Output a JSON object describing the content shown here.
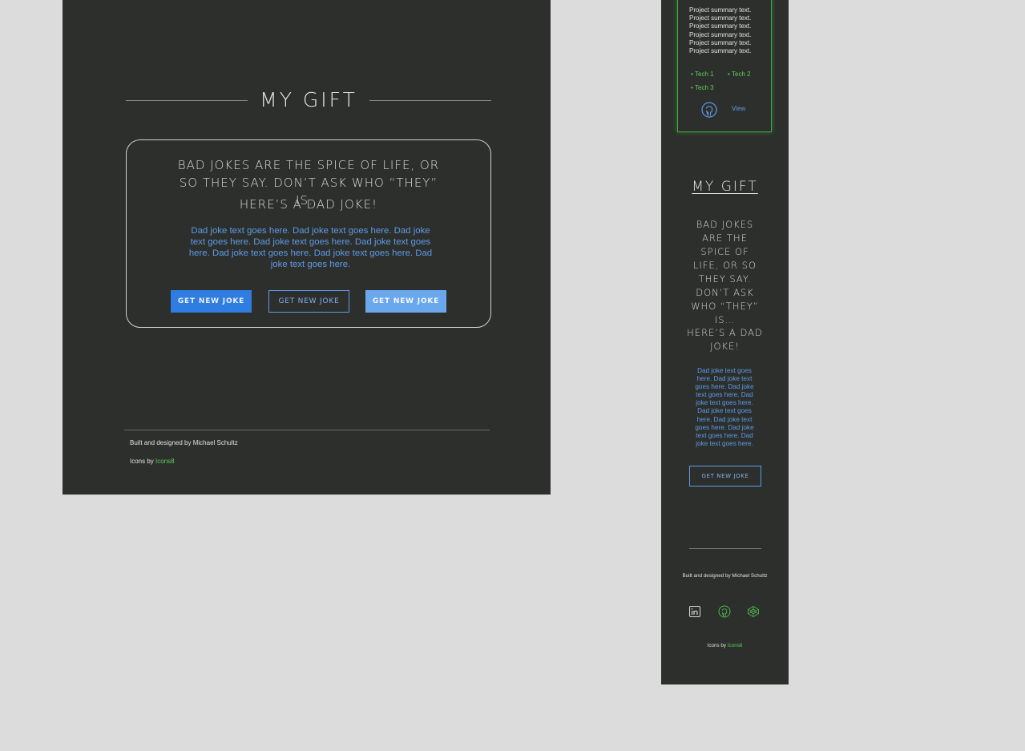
{
  "desktop": {
    "title": "MY GIFT",
    "card": {
      "heading": "BAD JOKES ARE THE SPICE OF LIFE, OR SO THEY SAY. DON’T ASK WHO “THEY” IS…",
      "subheading": "HERE’S A DAD JOKE!",
      "joke": "Dad joke text goes here. Dad joke text goes here. Dad joke text goes here. Dad joke text goes here. Dad joke text goes here. Dad joke text goes here. Dad joke text goes here. Dad joke text goes here.",
      "buttons": [
        {
          "label": "GET NEW JOKE",
          "state": "filled"
        },
        {
          "label": "GET NEW JOKE",
          "state": "outline"
        },
        {
          "label": "GET NEW JOKE",
          "state": "hover"
        }
      ]
    },
    "footer": {
      "built": "Built and designed by Michael Schultz",
      "icons_prefix": "Icons by ",
      "icons_link": "Icons8"
    }
  },
  "mobile": {
    "project_card": {
      "summary_lines": [
        "Project summary text.",
        "Project summary text.",
        "Project summary text.",
        "Project summary text.",
        "Project summary text.",
        "Project summary text."
      ],
      "techs": [
        "Tech 1",
        "Tech 2",
        "Tech 3"
      ],
      "view_label": "View",
      "icon": "github-icon"
    },
    "title": "MY GIFT",
    "heading": "BAD JOKES ARE THE SPICE OF LIFE, OR SO THEY SAY. DON’T ASK WHO “THEY” IS…",
    "subheading": "HERE’S A DAD JOKE!",
    "joke": "Dad joke text goes here. Dad joke text goes here. Dad joke text goes here. Dad joke text goes here. Dad joke text goes here. Dad joke text goes here. Dad joke text goes here. Dad joke text goes here.",
    "button_label": "GET NEW JOKE",
    "footer": {
      "built": "Built and designed by Michael Schultz",
      "social_icons": [
        "linkedin-icon",
        "github-icon",
        "codepen-icon"
      ],
      "icons_prefix": "Icons by ",
      "icons_link": "Icons8"
    }
  },
  "colors": {
    "background": "#dcdcdc",
    "frame": "#2d2f2c",
    "accent_blue": "#2f7de0",
    "link_blue": "#5d9be8",
    "accent_green": "#5bd05b"
  }
}
